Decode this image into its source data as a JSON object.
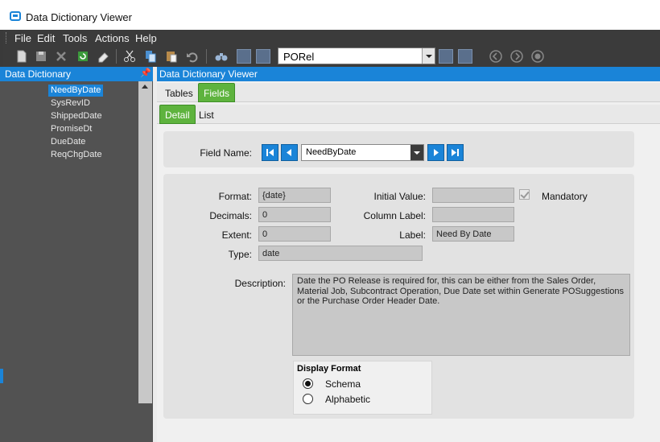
{
  "window": {
    "title": "Data Dictionary Viewer"
  },
  "menu": [
    "File",
    "Edit",
    "Tools",
    "Actions",
    "Help"
  ],
  "toolbar": {
    "combo_value": "PORel"
  },
  "left_panel": {
    "title": "Data Dictionary",
    "items": [
      "NeedByDate",
      "SysRevID",
      "ShippedDate",
      "PromiseDt",
      "DueDate",
      "ReqChgDate"
    ],
    "selected_index": 0
  },
  "right_panel": {
    "title": "Data Dictionary Viewer",
    "tabs": [
      "Tables",
      "Fields"
    ],
    "active_tab": "Fields",
    "subtabs": [
      "Detail",
      "List"
    ],
    "active_subtab": "Detail"
  },
  "field_name": {
    "label": "Field Name:",
    "value": "NeedByDate"
  },
  "form": {
    "format_label": "Format:",
    "format_value": "{date}",
    "decimals_label": "Decimals:",
    "decimals_value": "0",
    "extent_label": "Extent:",
    "extent_value": "0",
    "type_label": "Type:",
    "type_value": "date",
    "initial_value_label": "Initial Value:",
    "initial_value": "",
    "column_label_label": "Column Label:",
    "column_label_value": "",
    "label_label": "Label:",
    "label_value": "Need By Date",
    "mandatory_label": "Mandatory",
    "description_label": "Description:",
    "description": "Date the PO Release is required for, this can be either from the Sales Order, Material Job, Subcontract Operation, Due Date set within Generate POSuggestions or the Purchase Order Header Date."
  },
  "display_format": {
    "title": "Display Format",
    "options": [
      "Schema",
      "Alphabetic"
    ],
    "selected": "Schema"
  }
}
